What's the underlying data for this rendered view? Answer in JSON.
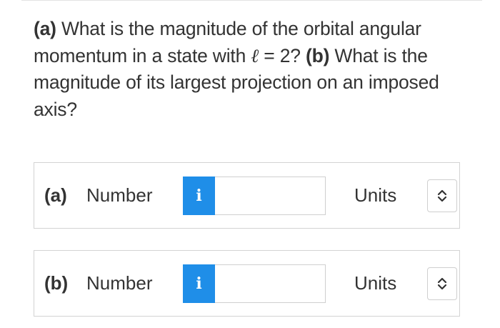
{
  "question": {
    "part_a_marker": "(a)",
    "part_a_text_1": " What is the magnitude of the orbital angular momentum in a state with ",
    "ell_symbol": "ℓ",
    "part_a_text_2": " = 2? ",
    "part_b_marker": "(b)",
    "part_b_text": " What is the magnitude of its largest projection on an imposed axis?"
  },
  "answers": [
    {
      "part_label": "(a)",
      "field_label": "Number",
      "info_label": "i",
      "input_value": "",
      "units_label": "Units"
    },
    {
      "part_label": "(b)",
      "field_label": "Number",
      "info_label": "i",
      "input_value": "",
      "units_label": "Units"
    }
  ],
  "colors": {
    "info_button": "#1f8ee8",
    "text": "#333333",
    "border": "#d3d3d3"
  },
  "icons": {
    "info": "info-icon",
    "units_dropdown": "chevron-up-down-icon"
  }
}
